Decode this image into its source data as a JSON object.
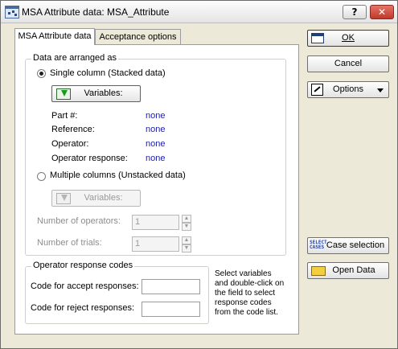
{
  "window": {
    "title": "MSA Attribute data: MSA_Attribute",
    "help_glyph": "?",
    "close_glyph": "✕"
  },
  "tabs": [
    "MSA Attribute data",
    "Acceptance options"
  ],
  "arrangement": {
    "group_title": "Data are arranged as",
    "single": {
      "label": "Single column (Stacked data)",
      "selected": true,
      "variables_button": "Variables:",
      "fields": [
        {
          "label": "Part #:",
          "value": "none"
        },
        {
          "label": "Reference:",
          "value": "none"
        },
        {
          "label": "Operator:",
          "value": "none"
        },
        {
          "label": "Operator response:",
          "value": "none"
        }
      ]
    },
    "multiple": {
      "label": "Multiple columns (Unstacked data)",
      "selected": false,
      "variables_button": "Variables:",
      "num_operators_label": "Number of operators:",
      "num_operators_value": "1",
      "num_trials_label": "Number of trials:",
      "num_trials_value": "1"
    }
  },
  "response_codes": {
    "group_title": "Operator response codes",
    "accept_label": "Code for accept responses:",
    "accept_value": "",
    "reject_label": "Code for reject responses:",
    "reject_value": "",
    "note": [
      "Select variables",
      "and double-click on",
      "the field to select",
      "response codes",
      "from the code list."
    ]
  },
  "side_buttons": {
    "ok": "OK",
    "cancel": "Cancel",
    "options": "Options",
    "case_selection": "Case selection",
    "case_icon_text": [
      "SELECT",
      "CASES"
    ],
    "open_data": "Open Data"
  },
  "colors": {
    "value_text": "#1d1da8",
    "disabled_text": "#8d8d8d",
    "close_button": "#c0392b"
  }
}
